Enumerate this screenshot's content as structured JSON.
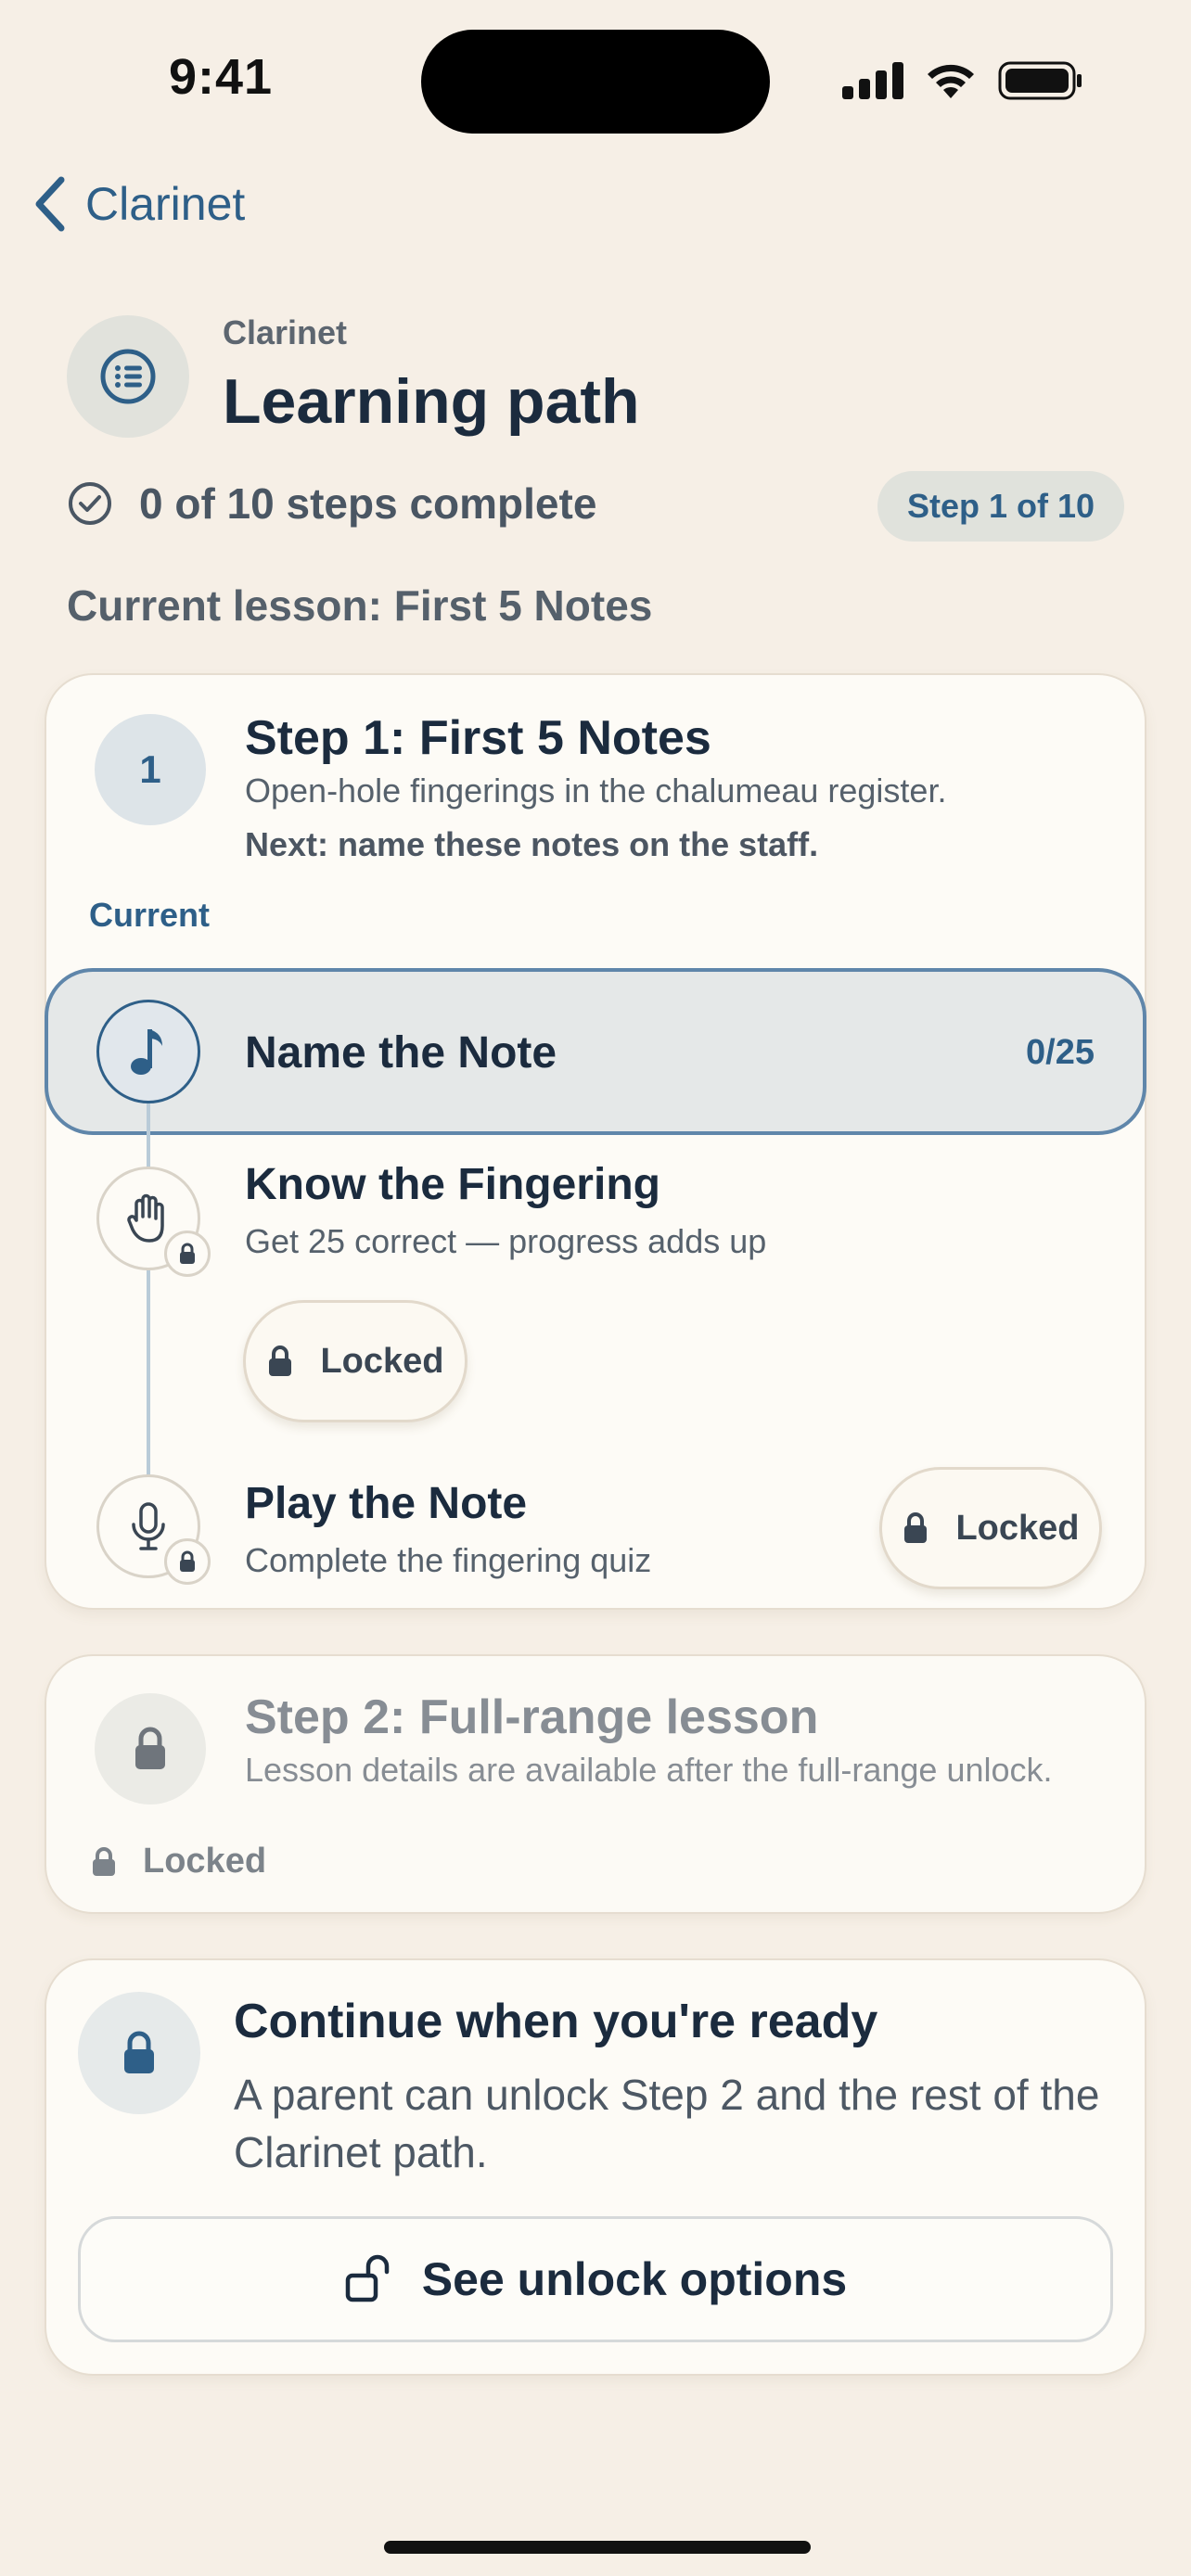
{
  "status_bar": {
    "time": "9:41"
  },
  "nav": {
    "back_label": "Clarinet"
  },
  "header": {
    "eyebrow": "Clarinet",
    "title": "Learning path",
    "progress_text": "0 of 10 steps complete",
    "step_badge": "Step 1 of 10",
    "current_lesson": "Current lesson: First 5 Notes"
  },
  "step1": {
    "number": "1",
    "title": "Step 1: First 5 Notes",
    "description": "Open-hole fingerings in the chalumeau register.",
    "next": "Next: name these notes on the staff.",
    "current_tag": "Current",
    "activities": [
      {
        "title": "Name the Note",
        "score": "0/25",
        "icon": "music-note-icon"
      },
      {
        "title": "Know the Fingering",
        "subtitle": "Get 25 correct — progress adds up",
        "locked_label": "Locked",
        "icon": "hand-icon"
      },
      {
        "title": "Play the Note",
        "subtitle": "Complete the fingering quiz",
        "locked_label": "Locked",
        "icon": "microphone-icon"
      }
    ]
  },
  "step2": {
    "title": "Step 2: Full-range lesson",
    "description": "Lesson details are available after the full-range unlock.",
    "locked_label": "Locked"
  },
  "unlock_card": {
    "title": "Continue when you're ready",
    "body": "A parent can unlock Step 2 and the rest of the Clarinet path.",
    "button_label": "See unlock options"
  },
  "colors": {
    "accent": "#2e5f88",
    "background": "#f6efe6",
    "card": "#fdfbf6"
  }
}
